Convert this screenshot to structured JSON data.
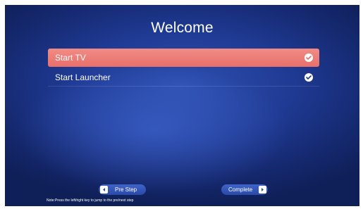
{
  "screen": {
    "title": "Welcome",
    "options": [
      {
        "label": "Start TV",
        "selected": true,
        "check_icon": "check-circle-icon"
      },
      {
        "label": "Start Launcher",
        "selected": false,
        "check_icon": "check-circle-icon"
      }
    ],
    "buttons": {
      "pre_step_label": "Pre Step",
      "pre_step_icon": "arrow-left-icon",
      "complete_label": "Complete",
      "complete_icon": "arrow-right-icon"
    },
    "note": "Note:Press the left/right key to jump to the pre/next step"
  },
  "colors": {
    "background": "#1f3a93",
    "highlight": "#e96f6a",
    "button": "#2a4aa8",
    "text": "#ffffff"
  }
}
